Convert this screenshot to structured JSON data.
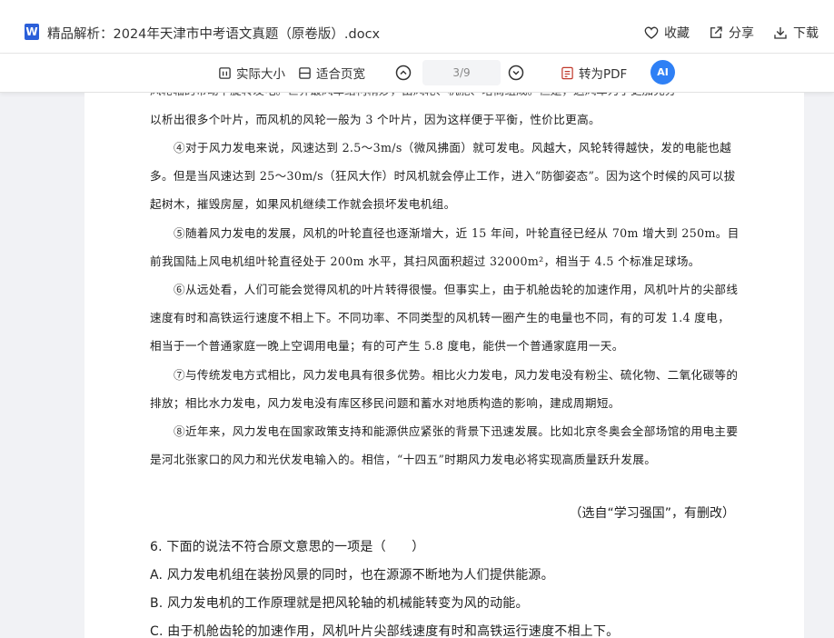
{
  "header": {
    "file_icon_letter": "W",
    "doc_title": "精品解析：2024年天津市中考语文真题（原卷版）.docx",
    "actions": [
      {
        "label": "收藏",
        "icon": "heart-icon"
      },
      {
        "label": "分享",
        "icon": "share-icon"
      },
      {
        "label": "下载",
        "icon": "download-icon"
      }
    ]
  },
  "toolbar": {
    "actual_size": "实际大小",
    "fit_page": "适合页宽",
    "page_indicator": "3/9",
    "to_pdf": "转为PDF",
    "ai_label": "AI",
    "accent_color": "#2f80f5"
  },
  "document": {
    "cut_top_line": "风轮轴的带动下旋转发电。世界最风车结构精妙，由风轮、机舱、塔筒组成。但是，这风车为了更加充分",
    "paragraphs": [
      "以析出很多个叶片，而风机的风轮一般为 3 个叶片，因为这样便于平衡，性价比更高。",
      "④对于风力发电来说，风速达到 2.5～3m/s（微风拂面）就可发电。风越大，风轮转得越快，发的电能也越多。但是当风速达到 25～30m/s（狂风大作）时风机就会停止工作，进入“防御姿态”。因为这个时候的风可以拔起树木，摧毁房屋，如果风机继续工作就会损坏发电机组。",
      "⑤随着风力发电的发展，风机的叶轮直径也逐渐增大，近 15 年间，叶轮直径已经从 70m 增大到 250m。目前我国陆上风电机组叶轮直径处于 200m 水平，其扫风面积超过 32000m²，相当于 4.5 个标准足球场。",
      "⑥从远处看，人们可能会觉得风机的叶片转得很慢。但事实上，由于机舱齿轮的加速作用，风机叶片的尖部线速度有时和高铁运行速度不相上下。不同功率、不同类型的风机转一圈产生的电量也不同，有的可发 1.4 度电，相当于一个普通家庭一晚上空调用电量；有的可产生 5.8 度电，能供一个普通家庭用一天。",
      "⑦与传统发电方式相比，风力发电具有很多优势。相比火力发电，风力发电没有粉尘、硫化物、二氧化碳等的排放；相比水力发电，风力发电没有库区移民问题和蓄水对地质构造的影响，建成周期短。",
      "⑧近年来，风力发电在国家政策支持和能源供应紧张的背景下迅速发展。比如北京冬奥会全部场馆的用电主要是河北张家口的风力和光伏发电输入的。相信，“十四五”时期风力发电必将实现高质量跃升发展。"
    ],
    "source": "（选自“学习强国”，有删改）",
    "question": "6. 下面的说法不符合原文意思的一项是（　　）",
    "options": [
      "A. 风力发电机组在装扮风景的同时，也在源源不断地为人们提供能源。",
      "B. 风力发电机的工作原理就是把风轮轴的机械能转变为风的动能。",
      "C. 由于机舱齿轮的加速作用，风机叶片尖部线速度有时和高铁运行速度不相上下。"
    ]
  }
}
